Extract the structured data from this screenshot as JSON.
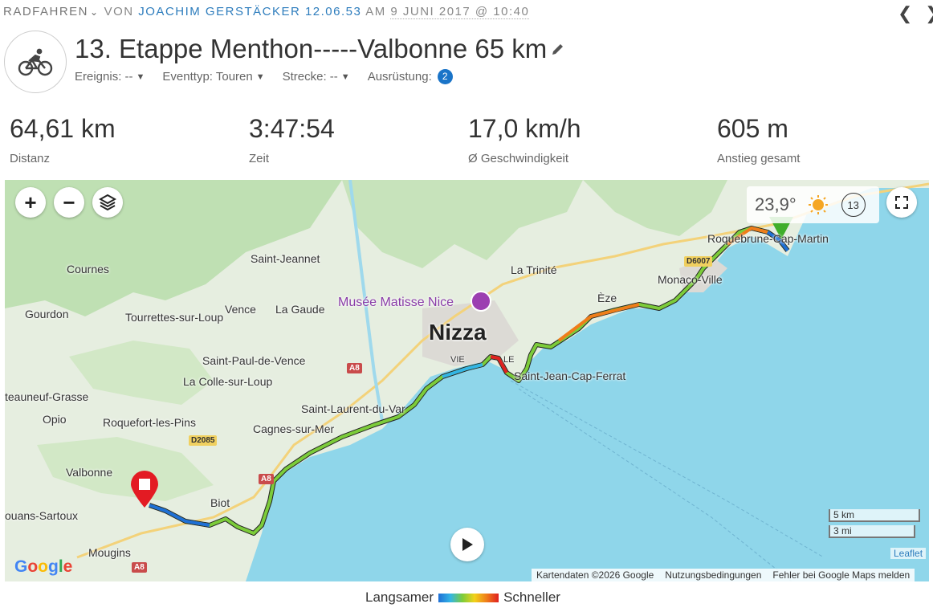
{
  "header": {
    "sport": "RADFAHREN",
    "by_label": "VON",
    "user": "JOACHIM GERSTÄCKER 12.06.53",
    "at_label": "AM",
    "date": "9 JUNI 2017 @ 10:40",
    "back_icon": "chevron-left-icon",
    "forward_icon": "chevron-right-icon"
  },
  "workout": {
    "title": "13. Etappe Menthon-----Valbonne 65 km",
    "sport_icon": "cyclist-icon",
    "filters": [
      {
        "label": "Ereignis: --"
      },
      {
        "label": "Eventtyp: Touren"
      },
      {
        "label": "Strecke: --"
      },
      {
        "label": "Ausrüstung:",
        "badge": "2"
      }
    ]
  },
  "stats": [
    {
      "value": "64,61 km",
      "label": "Distanz"
    },
    {
      "value": "3:47:54",
      "label": "Zeit"
    },
    {
      "value": "17,0 km/h",
      "label": "Ø Geschwindigkeit"
    },
    {
      "value": "605 m",
      "label": "Anstieg gesamt"
    }
  ],
  "map": {
    "weather": {
      "temp": "23,9°",
      "wind": "13"
    },
    "places": [
      {
        "name": "Cournes"
      },
      {
        "name": "Saint-Jeannet"
      },
      {
        "name": "La Trinité"
      },
      {
        "name": "Gourdon"
      },
      {
        "name": "Tourrettes-sur-Loup"
      },
      {
        "name": "Vence"
      },
      {
        "name": "La Gaude"
      },
      {
        "name": "Musée Matisse Nice"
      },
      {
        "name": "Nizza"
      },
      {
        "name": "Èze"
      },
      {
        "name": "Monaco-Ville"
      },
      {
        "name": "Roquebrune-Cap-Martin"
      },
      {
        "name": "Saint-Paul-de-Vence"
      },
      {
        "name": "La Colle-sur-Loup"
      },
      {
        "name": "Saint-Jean-Cap-Ferrat"
      },
      {
        "name": "teauneuf-Grasse"
      },
      {
        "name": "Saint-Laurent-du-Var"
      },
      {
        "name": "Opio"
      },
      {
        "name": "Roquefort-les-Pins"
      },
      {
        "name": "Cagnes-sur-Mer"
      },
      {
        "name": "Valbonne"
      },
      {
        "name": "Biot"
      },
      {
        "name": "ouans-Sartoux"
      },
      {
        "name": "Mougins"
      },
      {
        "name": "VIE"
      },
      {
        "name": "LE"
      }
    ],
    "roads": [
      "A8",
      "A8",
      "A8",
      "D2085",
      "D6007"
    ],
    "scale": {
      "km": "5 km",
      "mi": "3 mi"
    },
    "attribution": [
      "Kartendaten ©2026 Google",
      "Nutzungsbedingungen",
      "Fehler bei Google Maps melden"
    ],
    "leaflet": "Leaflet",
    "google_logo": "Google"
  },
  "legend": {
    "slower": "Langsamer",
    "faster": "Schneller"
  }
}
